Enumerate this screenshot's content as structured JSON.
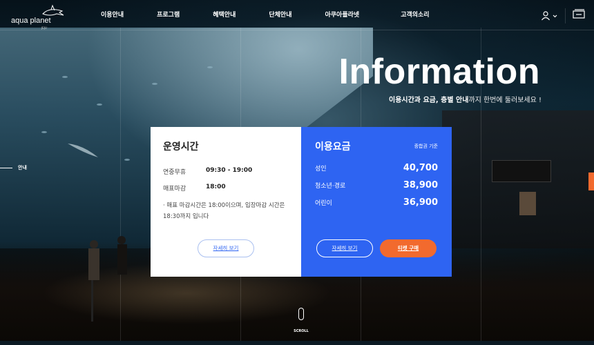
{
  "brand": {
    "name": "aqua planet",
    "sub": "JEJU"
  },
  "nav": [
    "이용안내",
    "프로그램",
    "혜택안내",
    "단체안내",
    "아쿠아플라넷",
    "고객의소리"
  ],
  "side": {
    "label": "안내"
  },
  "hero": {
    "title": "Information",
    "subtitle_bold": "이용시간과 요금, 층별 안내",
    "subtitle_rest": "까지 한번에 둘러보세요 !"
  },
  "hours": {
    "title": "운영시간",
    "rows": [
      {
        "label": "연중무휴",
        "value": "09:30 - 19:00"
      },
      {
        "label": "매표마감",
        "value": "18:00"
      }
    ],
    "note": "· 매표 마감시간은 18:00이으며, 입장마감 시간은 18:30까지 입니다",
    "more_button": "자세히 보기"
  },
  "fees": {
    "title": "이용요금",
    "basis": "종합권 기준",
    "rows": [
      {
        "label": "성인",
        "value": "40,700"
      },
      {
        "label": "청소년·경로",
        "value": "38,900"
      },
      {
        "label": "어린이",
        "value": "36,900"
      }
    ],
    "more_button": "자세히 보기",
    "buy_button": "티켓 구매"
  },
  "scroll": "SCROLL",
  "colors": {
    "accent_blue": "#2e64f2",
    "accent_orange": "#f26a2e"
  }
}
